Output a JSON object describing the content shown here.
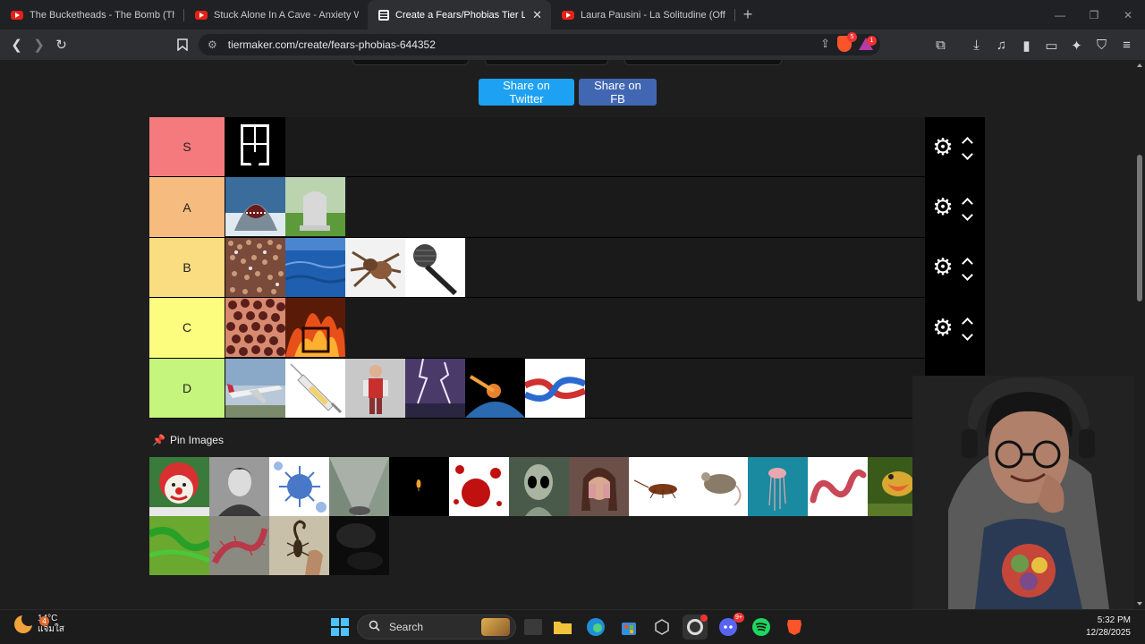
{
  "browser": {
    "tabs": [
      {
        "title": "The Bucketheads - The Bomb (These",
        "icon": "youtube-icon",
        "active": false
      },
      {
        "title": "Stuck Alone In A Cave - Anxiety Warn",
        "icon": "youtube-icon",
        "active": false
      },
      {
        "title": "Create a Fears/Phobias Tier List",
        "icon": "tiermaker-icon",
        "active": true
      },
      {
        "title": "Laura Pausini - La Solitudine (Official",
        "icon": "youtube-icon",
        "active": false
      }
    ],
    "new_tab": "+",
    "url": "tiermaker.com/create/fears-phobias-644352",
    "brave_shield_count": "5",
    "rewards_count": "1"
  },
  "share": {
    "twitter_label": "Share on Twitter",
    "fb_label": "Share on FB"
  },
  "tiers": [
    {
      "label": "S",
      "color": "#f47a7e",
      "items": [
        "window-shadow"
      ]
    },
    {
      "label": "A",
      "color": "#f6bb7e",
      "items": [
        "shark",
        "gravestone"
      ]
    },
    {
      "label": "B",
      "color": "#f9dd80",
      "items": [
        "crowd",
        "ocean",
        "tarantula",
        "microphone"
      ]
    },
    {
      "label": "C",
      "color": "#fcfd7f",
      "items": [
        "holes",
        "fire"
      ]
    },
    {
      "label": "D",
      "color": "#c5f57d",
      "items": [
        "airplane",
        "syringe",
        "puppet",
        "lightning",
        "meteor-earth",
        "knot"
      ]
    }
  ],
  "pin_images": {
    "label": "Pin Images",
    "items": [
      "clown",
      "man-portrait",
      "virus",
      "heights",
      "candle-dark",
      "blood",
      "alien",
      "scared-woman",
      "cockroach-mouse",
      "jellyfish",
      "worm",
      "lizard",
      "green-snake",
      "centipede",
      "scorpion-hand",
      "dark-fog"
    ]
  },
  "taskbar": {
    "temperature": "14°C",
    "weather_text": "แจ่มใส",
    "weather_badge": "4",
    "search_label": "Search",
    "discord_badge": "9+",
    "time": "5:32 PM",
    "date": "12/28/2025"
  }
}
